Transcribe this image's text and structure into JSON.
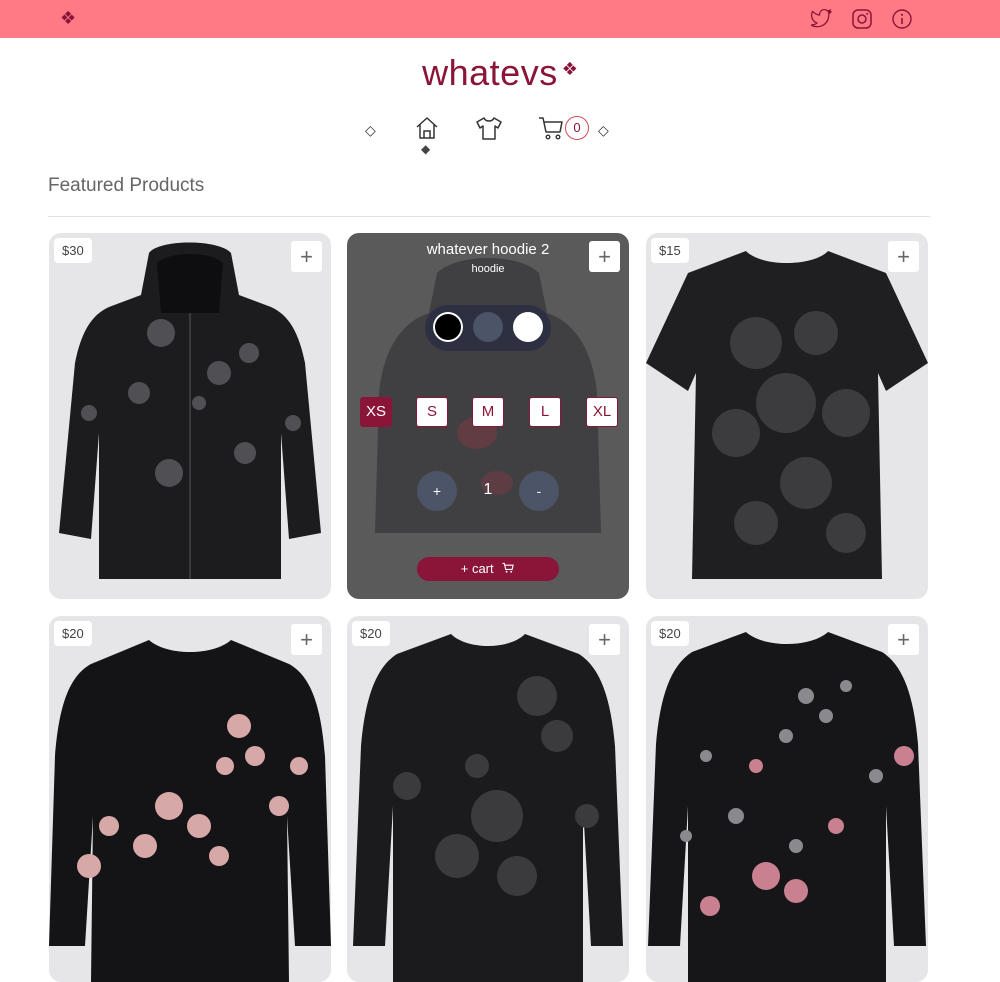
{
  "brand": {
    "title": "whatevs",
    "diamond": "❖"
  },
  "topbar": {
    "logo": "❖",
    "icons": [
      "twitter-icon",
      "instagram-icon",
      "info-icon"
    ]
  },
  "nav": {
    "left_marker": "◇",
    "right_marker": "◇",
    "active_marker": "◆",
    "items": [
      "home-icon",
      "shirt-icon",
      "cart-icon"
    ],
    "cart_count": "0"
  },
  "section": {
    "title": "Featured Products"
  },
  "colors": {
    "accent": "#8a1538",
    "topbar": "#ff7a85"
  },
  "products": [
    {
      "price": "$30",
      "add": "+"
    },
    {
      "price": "",
      "add": "+"
    },
    {
      "price": "$15",
      "add": "+"
    },
    {
      "price": "$20",
      "add": "+"
    },
    {
      "price": "$20",
      "add": "+"
    },
    {
      "price": "$20",
      "add": "+"
    }
  ],
  "featured": {
    "title": "whatever hoodie 2",
    "subtitle": "hoodie",
    "swatches": [
      "#000000",
      "#4c5468",
      "#ffffff"
    ],
    "sizes": [
      "XS",
      "S",
      "M",
      "L",
      "XL"
    ],
    "selected_size": "XS",
    "qty_plus": "+",
    "qty": "1",
    "qty_minus": "-",
    "add_to_cart": "+ cart"
  }
}
